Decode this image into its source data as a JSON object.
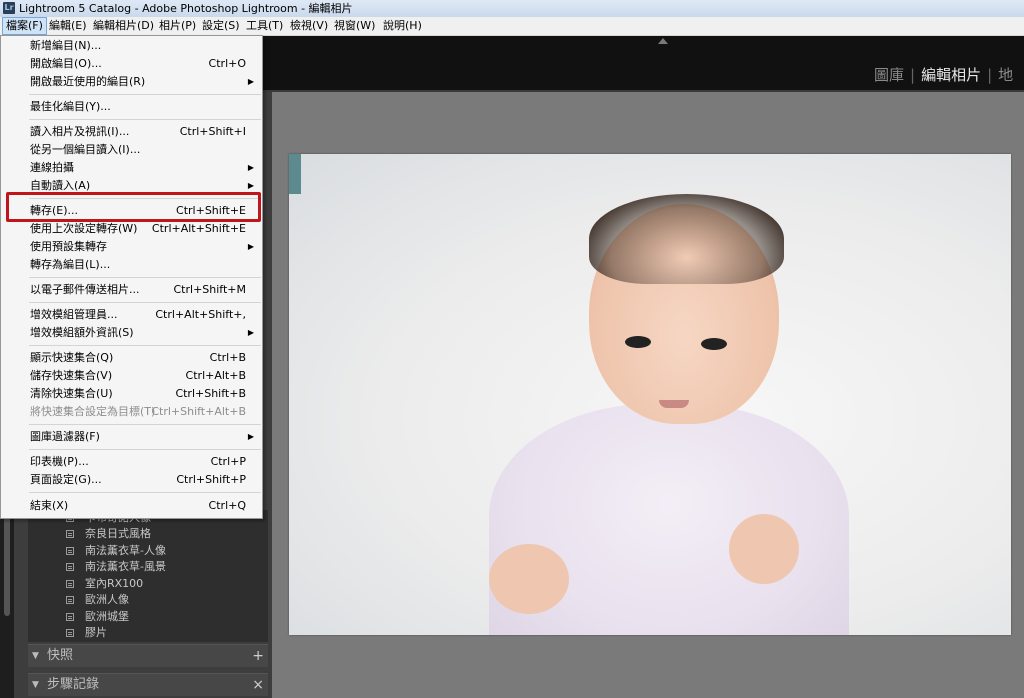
{
  "window": {
    "title": "Lightroom 5 Catalog - Adobe Photoshop Lightroom - 編輯相片",
    "icon_text": "Lr"
  },
  "menubar": [
    "檔案(F)",
    "編輯(E)",
    "編輯相片(D)",
    "相片(P)",
    "設定(S)",
    "工具(T)",
    "檢視(V)",
    "視窗(W)",
    "說明(H)"
  ],
  "modules": [
    "圖庫",
    "編輯相片",
    "地"
  ],
  "file_menu": {
    "items": [
      {
        "label": "新增編目(N)...",
        "shortcut": ""
      },
      {
        "label": "開啟編目(O)...",
        "shortcut": "Ctrl+O"
      },
      {
        "label": "開啟最近使用的編目(R)",
        "shortcut": "",
        "submenu": true
      },
      {
        "label": "最佳化編目(Y)...",
        "shortcut": ""
      },
      {
        "label": "讀入相片及視訊(I)...",
        "shortcut": "Ctrl+Shift+I"
      },
      {
        "label": "從另一個編目讀入(I)...",
        "shortcut": ""
      },
      {
        "label": "連線拍攝",
        "shortcut": "",
        "submenu": true
      },
      {
        "label": "自動讀入(A)",
        "shortcut": "",
        "submenu": true
      },
      {
        "label": "轉存(E)...",
        "shortcut": "Ctrl+Shift+E"
      },
      {
        "label": "使用上次設定轉存(W)",
        "shortcut": "Ctrl+Alt+Shift+E"
      },
      {
        "label": "使用預設集轉存",
        "shortcut": "",
        "submenu": true
      },
      {
        "label": "轉存為編目(L)...",
        "shortcut": ""
      },
      {
        "label": "以電子郵件傳送相片...",
        "shortcut": "Ctrl+Shift+M"
      },
      {
        "label": "增效模組管理員...",
        "shortcut": "Ctrl+Alt+Shift+,"
      },
      {
        "label": "增效模組額外資訊(S)",
        "shortcut": "",
        "submenu": true
      },
      {
        "label": "顯示快速集合(Q)",
        "shortcut": "Ctrl+B"
      },
      {
        "label": "儲存快速集合(V)",
        "shortcut": "Ctrl+Alt+B"
      },
      {
        "label": "清除快速集合(U)",
        "shortcut": "Ctrl+Shift+B"
      },
      {
        "label": "將快速集合設定為目標(T)",
        "shortcut": "Ctrl+Shift+Alt+B",
        "disabled": true
      },
      {
        "label": "圖庫過濾器(F)",
        "shortcut": "",
        "submenu": true
      },
      {
        "label": "印表機(P)...",
        "shortcut": "Ctrl+P"
      },
      {
        "label": "頁面設定(G)...",
        "shortcut": "Ctrl+Shift+P"
      },
      {
        "label": "結束(X)",
        "shortcut": "Ctrl+Q"
      }
    ]
  },
  "collections": [
    "卡布奇諾人像",
    "奈良日式風格",
    "南法薰衣草-人像",
    "南法薰衣草-風景",
    "室內RX100",
    "歐洲人像",
    "歐洲城堡",
    "膠片"
  ],
  "panels": {
    "snapshots": {
      "title": "快照",
      "button": "+"
    },
    "history": {
      "title": "步驟記錄",
      "button": "×"
    }
  },
  "colors": {
    "highlight_box": "#c0151b",
    "menu_bg": "#f5f5f5",
    "center_bg": "#7a7a7a"
  }
}
